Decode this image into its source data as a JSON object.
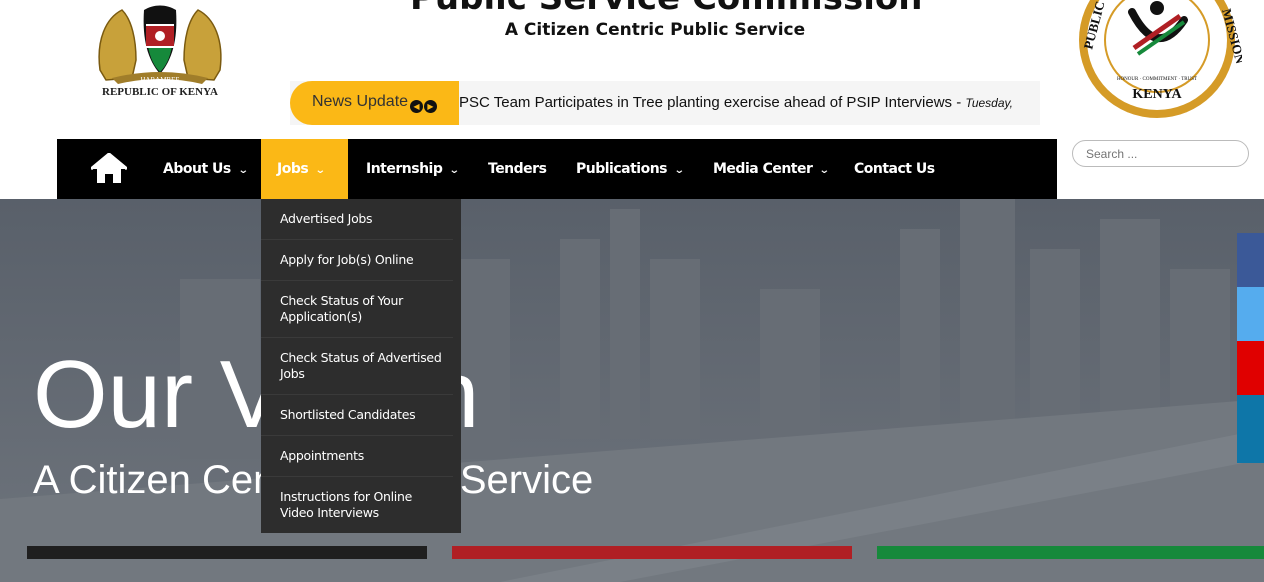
{
  "header": {
    "coat_caption": "REPUBLIC OF KENYA",
    "title": "Public Service Commission",
    "tagline": "A Citizen Centric Public Service"
  },
  "news": {
    "label": "News Update",
    "text": "PSC Team Participates in Tree planting exercise ahead of PSIP Interviews - ",
    "date": "Tuesday,"
  },
  "nav": {
    "items": [
      {
        "label": "About Us"
      },
      {
        "label": "Jobs"
      },
      {
        "label": "Internship"
      },
      {
        "label": "Tenders"
      },
      {
        "label": "Publications"
      },
      {
        "label": "Media Center"
      },
      {
        "label": "Contact Us"
      }
    ]
  },
  "search": {
    "placeholder": "Search ..."
  },
  "jobs_menu": [
    "Advertised Jobs",
    "Apply for Job(s) Online",
    "Check Status of Your Application(s)",
    "Check Status of Advertised Jobs",
    "Shortlisted Candidates",
    "Appointments",
    "Instructions for Online Video Interviews"
  ],
  "hero": {
    "title": "Our Vision",
    "subtitle": "A Citizen Centric Public Service"
  },
  "colors": {
    "accent": "#fbb816",
    "nav_bg": "#000000",
    "dropdown_bg": "#2d2d2d",
    "stripe_black": "#1f1f1f",
    "stripe_red": "#b01f24",
    "stripe_green": "#16893b",
    "facebook": "#3b5998",
    "twitter": "#55acee",
    "youtube": "#e00000",
    "linkedin": "#0e76a8"
  }
}
